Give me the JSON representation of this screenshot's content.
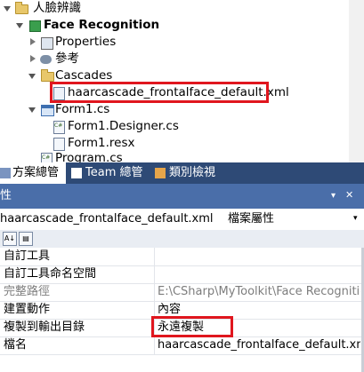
{
  "solution_explorer": {
    "items": [
      {
        "label": "人臉辨識",
        "icon": "folder-icon"
      },
      {
        "label": "Face Recognition",
        "icon": "csharp-project-icon"
      },
      {
        "label": "Properties",
        "icon": "properties-icon"
      },
      {
        "label": "參考",
        "icon": "references-icon"
      },
      {
        "label": "Cascades",
        "icon": "folder-icon"
      },
      {
        "label": "haarcascade_frontalface_default.xml",
        "icon": "xml-file-icon",
        "selected": true
      },
      {
        "label": "Form1.cs",
        "icon": "form-icon"
      },
      {
        "label": "Form1.Designer.cs",
        "icon": "cs-file-icon"
      },
      {
        "label": "Form1.resx",
        "icon": "resx-file-icon"
      },
      {
        "label": "Program.cs",
        "icon": "cs-file-icon"
      }
    ]
  },
  "tabs": [
    {
      "label": "方案總管",
      "icon": "solution-explorer-icon",
      "active": true
    },
    {
      "label": "Team 總管",
      "icon": "team-explorer-icon",
      "active": false
    },
    {
      "label": "類別檢視",
      "icon": "class-view-icon",
      "active": false
    }
  ],
  "properties": {
    "title": "性",
    "object_name": "haarcascade_frontalface_default.xml",
    "object_type": "檔案屬性",
    "dropdown_icon": "dropdown-arrow-icon",
    "rows": [
      {
        "name": "自訂工具",
        "value": "",
        "dim": false
      },
      {
        "name": "自訂工具命名空間",
        "value": "",
        "dim": false
      },
      {
        "name": "完整路徑",
        "value": "E:\\CSharp\\MyToolkit\\Face Recognition",
        "dim": true
      },
      {
        "name": "建置動作",
        "value": "內容",
        "dim": false
      },
      {
        "name": "複製到輸出目錄",
        "value": "永遠複製",
        "dim": false
      },
      {
        "name": "檔名",
        "value": "haarcascade_frontalface_default.xml",
        "dim": false
      }
    ]
  },
  "colors": {
    "highlight": "#e0161e",
    "tab_bar": "#2e4a76",
    "panel_header": "#4a6ea9"
  }
}
